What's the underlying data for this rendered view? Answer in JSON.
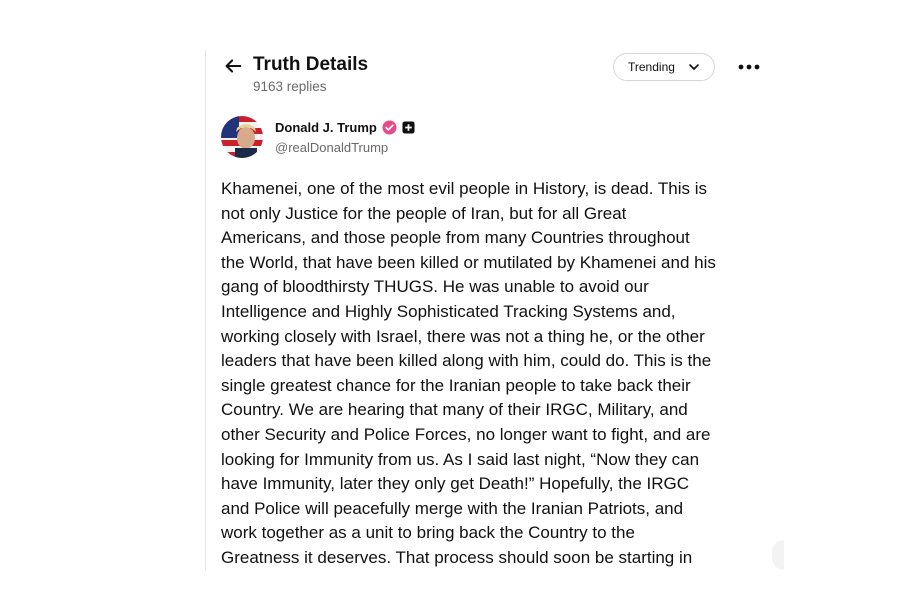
{
  "header": {
    "title": "Truth Details",
    "replies": "9163 replies",
    "sort_label": "Trending"
  },
  "post": {
    "author_name": "Donald J. Trump",
    "author_handle": "@realDonaldTrump",
    "text": "Khamenei, one of the most evil people in History, is dead. This is\nnot only Justice for the people of Iran, but for all Great\nAmericans, and those people from many Countries throughout\nthe World, that have been killed or mutilated by Khamenei and his\ngang of bloodthirsty THUGS. He was unable to avoid our\nIntelligence and Highly Sophisticated Tracking Systems and,\nworking closely with Israel, there was not a thing he, or the other\nleaders that have been killed along with him, could do. This is the\nsingle greatest chance for the Iranian people to take back their\nCountry. We are hearing that many of their IRGC, Military, and\nother Security and Police Forces, no longer want to fight, and are\nlooking for Immunity from us. As I said last night, “Now they can\nhave Immunity, later they only get Death!” Hopefully, the IRGC\nand Police will peacefully merge with the Iranian Patriots, and\nwork together as a unit to bring back the Country to the\nGreatness it deserves. That process should soon be starting in"
  },
  "icons": {
    "back": "arrow-left-icon",
    "sort": "chevron-down-icon",
    "more": "more-horizontal-icon",
    "verified": "verified-badge-icon",
    "plus": "plus-badge-icon"
  },
  "colors": {
    "verified": "#e8498b",
    "muted_text": "#6a6a6a"
  }
}
